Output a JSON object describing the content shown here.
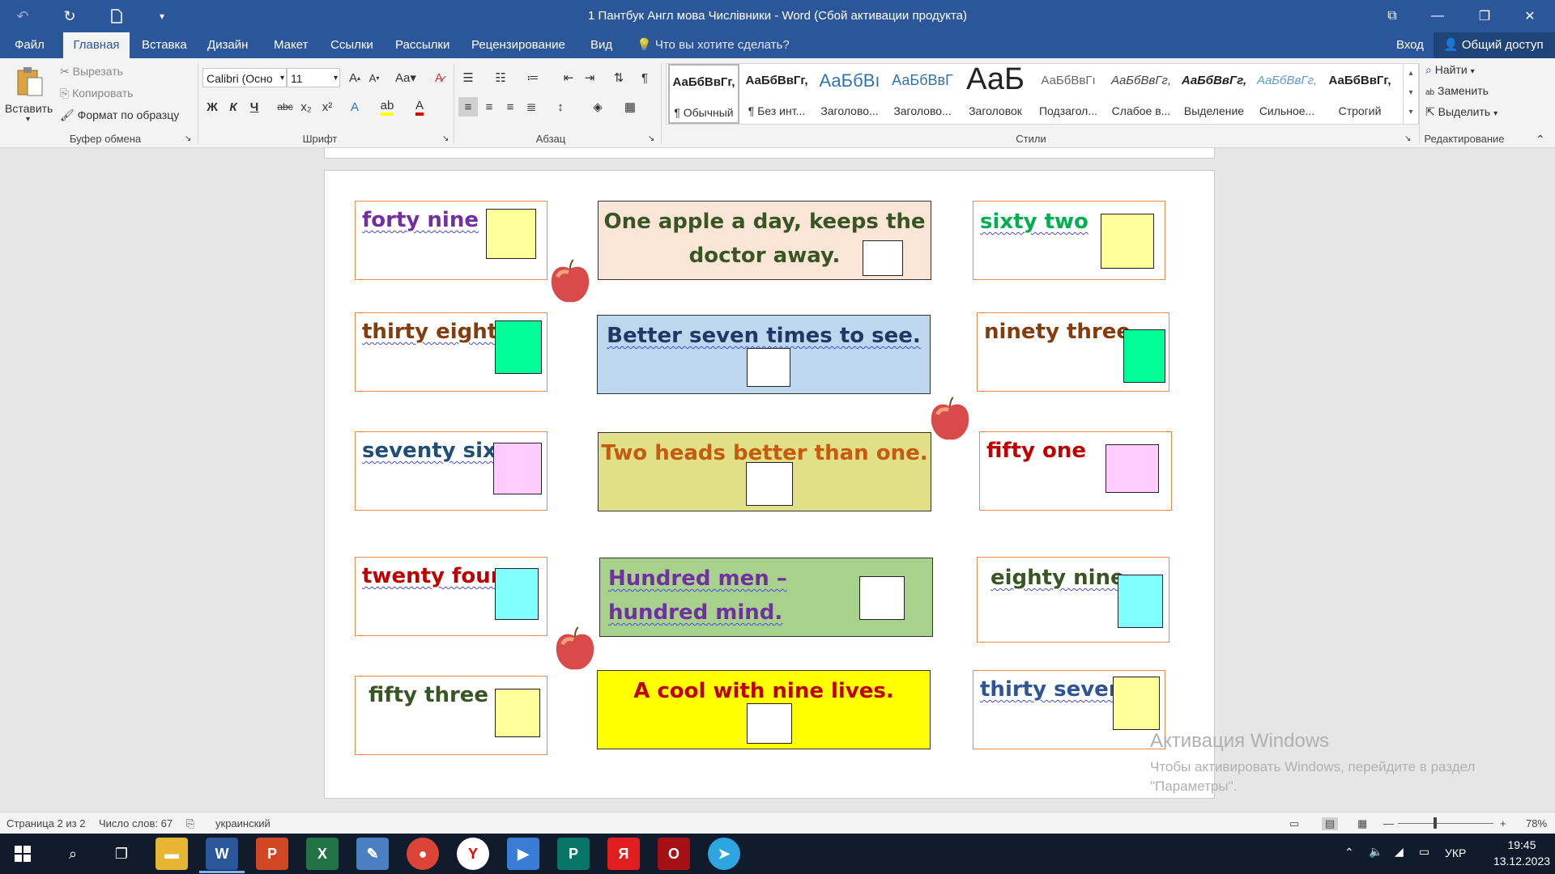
{
  "titlebar": {
    "doc_title": "1 Пантбук  Англ мова Числівники - Word (Сбой активации продукта)"
  },
  "tabs": [
    "Файл",
    "Главная",
    "Вставка",
    "Дизайн",
    "Макет",
    "Ссылки",
    "Рассылки",
    "Рецензирование",
    "Вид"
  ],
  "tell_me": "Что вы хотите сделать?",
  "account": {
    "signin": "Вход",
    "share": "Общий доступ"
  },
  "clipboard": {
    "paste": "Вставить",
    "cut": "Вырезать",
    "copy": "Копировать",
    "format_painter": "Формат по образцу",
    "label": "Буфер обмена"
  },
  "font": {
    "name": "Calibri (Осно",
    "size": "11",
    "label": "Шрифт",
    "bold": "Ж",
    "italic": "К",
    "underline": "Ч",
    "strike": "abc",
    "sub": "x₂",
    "sup": "x²",
    "case": "Aa"
  },
  "paragraph": {
    "label": "Абзац"
  },
  "styles": {
    "label": "Стили",
    "items": [
      {
        "preview": "АаБбВвГг,",
        "name": "¶ Обычный"
      },
      {
        "preview": "АаБбВвГг,",
        "name": "¶ Без инт..."
      },
      {
        "preview": "АаБбВı",
        "name": "Заголово..."
      },
      {
        "preview": "АаБбВвГ",
        "name": "Заголово..."
      },
      {
        "preview": "АаБ",
        "name": "Заголовок"
      },
      {
        "preview": "АаБбВвГı",
        "name": "Подзагол..."
      },
      {
        "preview": "АаБбВвГг,",
        "name": "Слабое в..."
      },
      {
        "preview": "АаБбВвГг,",
        "name": "Выделение"
      },
      {
        "preview": "АаБбВвГг,",
        "name": "Сильное..."
      },
      {
        "preview": "АаБбВвГг,",
        "name": "Строгий"
      }
    ]
  },
  "editing": {
    "find": "Найти",
    "replace": "Заменить",
    "select": "Выделить",
    "label": "Редактирование"
  },
  "document": {
    "numbers_left": [
      {
        "text": "forty  nine",
        "color": "#7030a0",
        "box": "#ffff99"
      },
      {
        "text": "thirty  eight",
        "color": "#843c0c",
        "box": "#00ff99"
      },
      {
        "text": "seventy  six",
        "color": "#1f4e79",
        "box": "#ffccff"
      },
      {
        "text": "twenty  four",
        "color": "#c00000",
        "box": "#80ffff"
      },
      {
        "text": "fifty   three",
        "color": "#375623",
        "box": "#ffff99"
      }
    ],
    "numbers_right": [
      {
        "text": "sixty  two",
        "color": "#00b050",
        "box": "#ffff99"
      },
      {
        "text": "ninety  three",
        "color": "#843c0c",
        "box": "#00ff99"
      },
      {
        "text": "fifty   one",
        "color": "#c00000",
        "box": "#ffccff"
      },
      {
        "text": "eighty  nine",
        "color": "#375623",
        "box": "#80ffff"
      },
      {
        "text": "thirty  seven",
        "color": "#2f5597",
        "box": "#ffff99"
      }
    ],
    "proverbs": [
      {
        "line1": "One apple a day, keeps the",
        "line2": "doctor away.",
        "color": "#375623",
        "bg": "#fbe5d6"
      },
      {
        "line1": "Better  seven  times to see.",
        "line2": "",
        "color": "#1f3864",
        "bg": "#bdd7ee"
      },
      {
        "line1": "Two heads better than one.",
        "line2": "",
        "color": "#c55a11",
        "bg": "#e2e087"
      },
      {
        "line1": "Hundred  men –",
        "line2": "hundred  mind.",
        "color": "#7030a0",
        "bg": "#a9d18e"
      },
      {
        "line1": "A cool with nine lives.",
        "line2": "",
        "color": "#c00000",
        "bg": "#ffff00"
      }
    ]
  },
  "watermark": {
    "title": "Активация Windows",
    "subtitle": "Чтобы активировать Windows, перейдите в раздел \"Параметры\"."
  },
  "statusbar": {
    "page": "Страница 2 из 2",
    "words": "Число слов: 67",
    "language": "украинский",
    "zoom": "78%"
  },
  "taskbar": {
    "lang": "УКР",
    "time": "19:45",
    "date": "13.12.2023",
    "icons": [
      "start-icon",
      "search-icon",
      "task-view-icon",
      "file-explorer-icon",
      "word-icon",
      "powerpoint-icon",
      "excel-icon",
      "paint-icon",
      "chrome-icon",
      "yandex-browser-icon",
      "video-player-icon",
      "publisher-icon",
      "yandex-icon",
      "opera-icon",
      "telegram-icon"
    ]
  }
}
